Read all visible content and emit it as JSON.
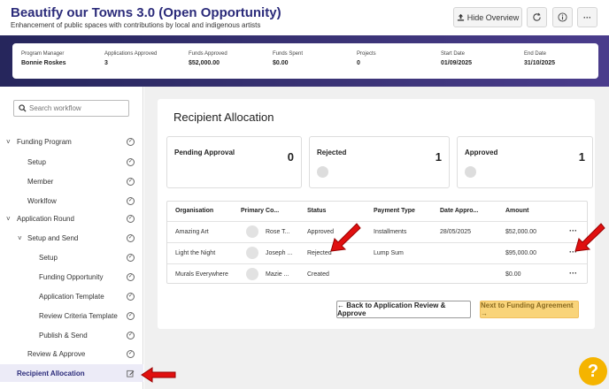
{
  "header": {
    "title": "Beautify our Towns 3.0 (Open Opportunity)",
    "subtitle": "Enhancement of public spaces with contributions by local and indigenous artists",
    "hide_overview_label": "Hide Overview",
    "refresh_icon": "refresh-icon",
    "info_icon": "info-icon",
    "more_label": "···"
  },
  "overview": [
    {
      "label": "Program Manager",
      "value": "Bonnie Roskes"
    },
    {
      "label": "Applications Approved",
      "value": "3"
    },
    {
      "label": "Funds Approved",
      "value": "$52,000.00"
    },
    {
      "label": "Funds Spent",
      "value": "$0.00"
    },
    {
      "label": "Projects",
      "value": "0"
    },
    {
      "label": "Start Date",
      "value": "01/09/2025"
    },
    {
      "label": "End Date",
      "value": "31/10/2025"
    }
  ],
  "sidebar": {
    "search_placeholder": "Search workflow",
    "items": [
      {
        "label": "Funding Program",
        "chevron": "˅"
      },
      {
        "label": "Setup",
        "chevron": ""
      },
      {
        "label": "Member",
        "chevron": ""
      },
      {
        "label": "Worklfow",
        "chevron": ""
      },
      {
        "label": "Application Round",
        "chevron": "˅"
      },
      {
        "label": "Setup and Send",
        "chevron": "˅"
      },
      {
        "label": "Setup",
        "chevron": ""
      },
      {
        "label": "Funding Opportunity",
        "chevron": ""
      },
      {
        "label": "Application Template",
        "chevron": ""
      },
      {
        "label": "Review Criteria Template",
        "chevron": ""
      },
      {
        "label": "Publish & Send",
        "chevron": ""
      },
      {
        "label": "Review & Approve",
        "chevron": ""
      },
      {
        "label": "Recipient Allocation",
        "chevron": ""
      }
    ]
  },
  "main": {
    "title": "Recipient Allocation",
    "stats": [
      {
        "label": "Pending Approval",
        "value": "0"
      },
      {
        "label": "Rejected",
        "value": "1"
      },
      {
        "label": "Approved",
        "value": "1"
      }
    ],
    "table": {
      "columns": [
        "Organisation",
        "Primary Co...",
        "Status",
        "Payment Type",
        "Date Appro...",
        "Amount"
      ],
      "rows": [
        {
          "org": "Amazing Art",
          "contact": "Rose T...",
          "status": "Approved",
          "payment": "Installments",
          "date": "28/05/2025",
          "amount": "$52,000.00"
        },
        {
          "org": "Light the Night",
          "contact": "Joseph ...",
          "status": "Rejected",
          "payment": "Lump Sum",
          "date": "",
          "amount": "$95,000.00"
        },
        {
          "org": "Murals Everywhere",
          "contact": "Mazie ...",
          "status": "Created",
          "payment": "",
          "date": "",
          "amount": "$0.00"
        }
      ],
      "row_menu": "···"
    },
    "back_button": "← Back to Application Review & Approve",
    "next_button": "Next to Funding Agreement →"
  },
  "help_label": "?",
  "accent_color": "#2b2b7a",
  "annotation_arrow_color": "#e01010"
}
